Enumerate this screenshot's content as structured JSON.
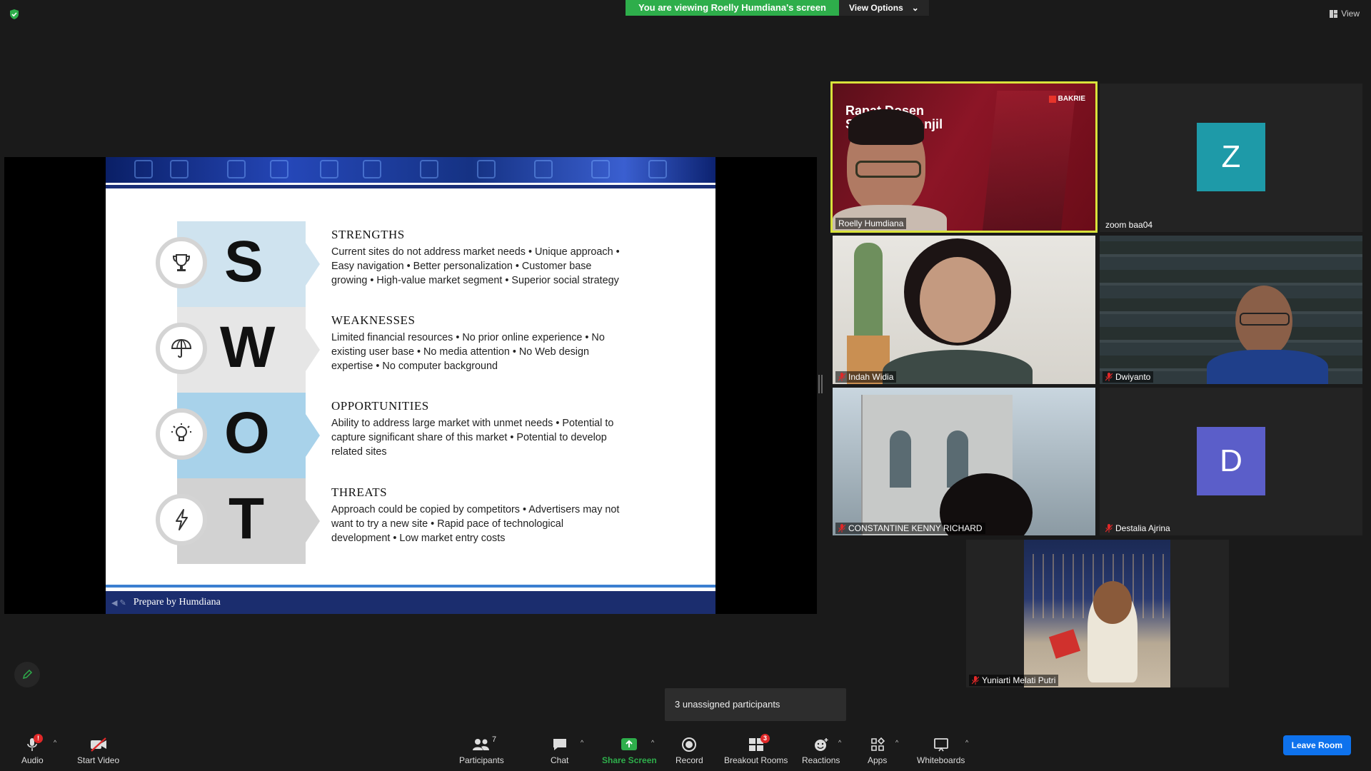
{
  "top": {
    "banner_text": "You are viewing Roelly Humdiana's screen",
    "view_options": "View Options",
    "view_button": "View"
  },
  "slide": {
    "footer": "Prepare by Humdiana",
    "rows": [
      {
        "letter": "S",
        "title": "STRENGTHS",
        "text": "Current sites do not address market needs • Unique approach • Easy navigation • Better personalization • Customer base growing • High-value market segment • Superior social strategy",
        "icon": "trophy-icon",
        "tab_color": "#cfe3ef"
      },
      {
        "letter": "W",
        "title": "WEAKNESSES",
        "text": "Limited financial resources • No prior online experience • No existing user base • No media attention  • No Web design expertise • No computer background",
        "icon": "umbrella-icon",
        "tab_color": "#e6e6e6"
      },
      {
        "letter": "O",
        "title": "OPPORTUNITIES",
        "text": "Ability to address large market with unmet needs • Potential to capture significant share of this market • Potential to develop related sites",
        "icon": "lightbulb-icon",
        "tab_color": "#a8d2ea"
      },
      {
        "letter": "T",
        "title": "THREATS",
        "text": "Approach could be  copied by competitors • Advertisers may not want to try a new site • Rapid pace of technological development • Low market entry costs",
        "icon": "lightning-icon",
        "tab_color": "#d2d2d2"
      }
    ]
  },
  "participants": {
    "tiles": [
      {
        "name": "Roelly Humdiana",
        "muted": false,
        "active": true,
        "video_text_1": "Rapat Dosen",
        "video_text_2": "Semester Ganjil",
        "logo": "BAKRIE"
      },
      {
        "name": "zoom baa04",
        "muted": false,
        "avatar_letter": "Z",
        "avatar_color": "#1e9aa8"
      },
      {
        "name": "Indah Widia",
        "muted": true
      },
      {
        "name": "Dwiyanto",
        "muted": true
      },
      {
        "name": "CONSTANTINE KENNY RICHARD",
        "muted": true
      },
      {
        "name": "Destalia Ajrina",
        "muted": true,
        "avatar_letter": "D",
        "avatar_color": "#5b5ec9"
      },
      {
        "name": "Yuniarti Melati Putri",
        "muted": true
      }
    ]
  },
  "toolbar": {
    "audio": "Audio",
    "audio_badge": "!",
    "start_video": "Start Video",
    "participants": "Participants",
    "participants_count": "7",
    "chat": "Chat",
    "share_screen": "Share Screen",
    "record": "Record",
    "breakout_rooms": "Breakout Rooms",
    "breakout_badge": "3",
    "reactions": "Reactions",
    "apps": "Apps",
    "whiteboards": "Whiteboards",
    "leave_room": "Leave Room"
  },
  "tooltip": "3 unassigned participants",
  "colors": {
    "accent_green": "#2eae4b",
    "leave_blue": "#0e72ed",
    "active_border": "#d8e23b"
  }
}
